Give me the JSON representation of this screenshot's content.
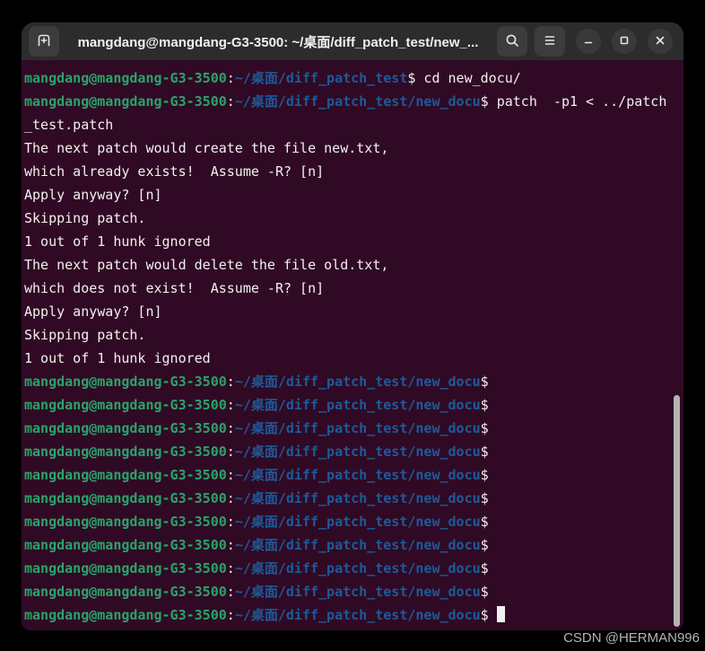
{
  "window": {
    "title": "mangdang@mangdang-G3-3500: ~/桌面/diff_patch_test/new_...",
    "header_icons": [
      "new-tab",
      "search",
      "menu",
      "minimize",
      "maximize",
      "close"
    ]
  },
  "colors": {
    "terminal_background": "#300a24",
    "header_background": "#2c2c2c",
    "prompt_user_green": "#2ba26c",
    "prompt_path_blue": "#1c5a9c",
    "foreground_text": "#f2f0ef",
    "scrollbar": "#b6b4b2"
  },
  "terminal": {
    "user_host": "mangdang@mangdang-G3-3500",
    "path_base": "~/桌面/diff_patch_test",
    "path_new": "~/桌面/diff_patch_test/new_docu",
    "commands": [
      "cd new_docu/",
      "patch  -p1 < ../patch_test.patch"
    ],
    "lines": [
      {
        "segs": [
          {
            "c": "green",
            "t": "mangdang@mangdang-G3-3500"
          },
          {
            "c": "fg",
            "t": ":"
          },
          {
            "c": "blue",
            "t": "~/桌面/diff_patch_test"
          },
          {
            "c": "fg",
            "t": "$ cd new_docu/"
          }
        ]
      },
      {
        "segs": [
          {
            "c": "green",
            "t": "mangdang@mangdang-G3-3500"
          },
          {
            "c": "fg",
            "t": ":"
          },
          {
            "c": "blue",
            "t": "~/桌面/diff_patch_test/new_docu"
          },
          {
            "c": "fg",
            "t": "$ patch  -p1 < ../patch"
          }
        ]
      },
      {
        "segs": [
          {
            "c": "fg",
            "t": "_test.patch"
          }
        ]
      },
      {
        "segs": [
          {
            "c": "fg",
            "t": "The next patch would create the file new.txt,"
          }
        ]
      },
      {
        "segs": [
          {
            "c": "fg",
            "t": "which already exists!  Assume -R? [n]"
          }
        ]
      },
      {
        "segs": [
          {
            "c": "fg",
            "t": "Apply anyway? [n]"
          }
        ]
      },
      {
        "segs": [
          {
            "c": "fg",
            "t": "Skipping patch."
          }
        ]
      },
      {
        "segs": [
          {
            "c": "fg",
            "t": "1 out of 1 hunk ignored"
          }
        ]
      },
      {
        "segs": [
          {
            "c": "fg",
            "t": "The next patch would delete the file old.txt,"
          }
        ]
      },
      {
        "segs": [
          {
            "c": "fg",
            "t": "which does not exist!  Assume -R? [n]"
          }
        ]
      },
      {
        "segs": [
          {
            "c": "fg",
            "t": "Apply anyway? [n]"
          }
        ]
      },
      {
        "segs": [
          {
            "c": "fg",
            "t": "Skipping patch."
          }
        ]
      },
      {
        "segs": [
          {
            "c": "fg",
            "t": "1 out of 1 hunk ignored"
          }
        ]
      },
      {
        "segs": [
          {
            "c": "green",
            "t": "mangdang@mangdang-G3-3500"
          },
          {
            "c": "fg",
            "t": ":"
          },
          {
            "c": "blue",
            "t": "~/桌面/diff_patch_test/new_docu"
          },
          {
            "c": "fg",
            "t": "$"
          }
        ]
      },
      {
        "segs": [
          {
            "c": "green",
            "t": "mangdang@mangdang-G3-3500"
          },
          {
            "c": "fg",
            "t": ":"
          },
          {
            "c": "blue",
            "t": "~/桌面/diff_patch_test/new_docu"
          },
          {
            "c": "fg",
            "t": "$"
          }
        ]
      },
      {
        "segs": [
          {
            "c": "green",
            "t": "mangdang@mangdang-G3-3500"
          },
          {
            "c": "fg",
            "t": ":"
          },
          {
            "c": "blue",
            "t": "~/桌面/diff_patch_test/new_docu"
          },
          {
            "c": "fg",
            "t": "$"
          }
        ]
      },
      {
        "segs": [
          {
            "c": "green",
            "t": "mangdang@mangdang-G3-3500"
          },
          {
            "c": "fg",
            "t": ":"
          },
          {
            "c": "blue",
            "t": "~/桌面/diff_patch_test/new_docu"
          },
          {
            "c": "fg",
            "t": "$"
          }
        ]
      },
      {
        "segs": [
          {
            "c": "green",
            "t": "mangdang@mangdang-G3-3500"
          },
          {
            "c": "fg",
            "t": ":"
          },
          {
            "c": "blue",
            "t": "~/桌面/diff_patch_test/new_docu"
          },
          {
            "c": "fg",
            "t": "$"
          }
        ]
      },
      {
        "segs": [
          {
            "c": "green",
            "t": "mangdang@mangdang-G3-3500"
          },
          {
            "c": "fg",
            "t": ":"
          },
          {
            "c": "blue",
            "t": "~/桌面/diff_patch_test/new_docu"
          },
          {
            "c": "fg",
            "t": "$"
          }
        ]
      },
      {
        "segs": [
          {
            "c": "green",
            "t": "mangdang@mangdang-G3-3500"
          },
          {
            "c": "fg",
            "t": ":"
          },
          {
            "c": "blue",
            "t": "~/桌面/diff_patch_test/new_docu"
          },
          {
            "c": "fg",
            "t": "$"
          }
        ]
      },
      {
        "segs": [
          {
            "c": "green",
            "t": "mangdang@mangdang-G3-3500"
          },
          {
            "c": "fg",
            "t": ":"
          },
          {
            "c": "blue",
            "t": "~/桌面/diff_patch_test/new_docu"
          },
          {
            "c": "fg",
            "t": "$"
          }
        ]
      },
      {
        "segs": [
          {
            "c": "green",
            "t": "mangdang@mangdang-G3-3500"
          },
          {
            "c": "fg",
            "t": ":"
          },
          {
            "c": "blue",
            "t": "~/桌面/diff_patch_test/new_docu"
          },
          {
            "c": "fg",
            "t": "$"
          }
        ]
      },
      {
        "segs": [
          {
            "c": "green",
            "t": "mangdang@mangdang-G3-3500"
          },
          {
            "c": "fg",
            "t": ":"
          },
          {
            "c": "blue",
            "t": "~/桌面/diff_patch_test/new_docu"
          },
          {
            "c": "fg",
            "t": "$"
          }
        ]
      },
      {
        "segs": [
          {
            "c": "green",
            "t": "mangdang@mangdang-G3-3500"
          },
          {
            "c": "fg",
            "t": ":"
          },
          {
            "c": "blue",
            "t": "~/桌面/diff_patch_test/new_docu"
          },
          {
            "c": "fg",
            "t": "$"
          }
        ],
        "cursor": true
      }
    ]
  },
  "watermark": "CSDN @HERMAN996"
}
